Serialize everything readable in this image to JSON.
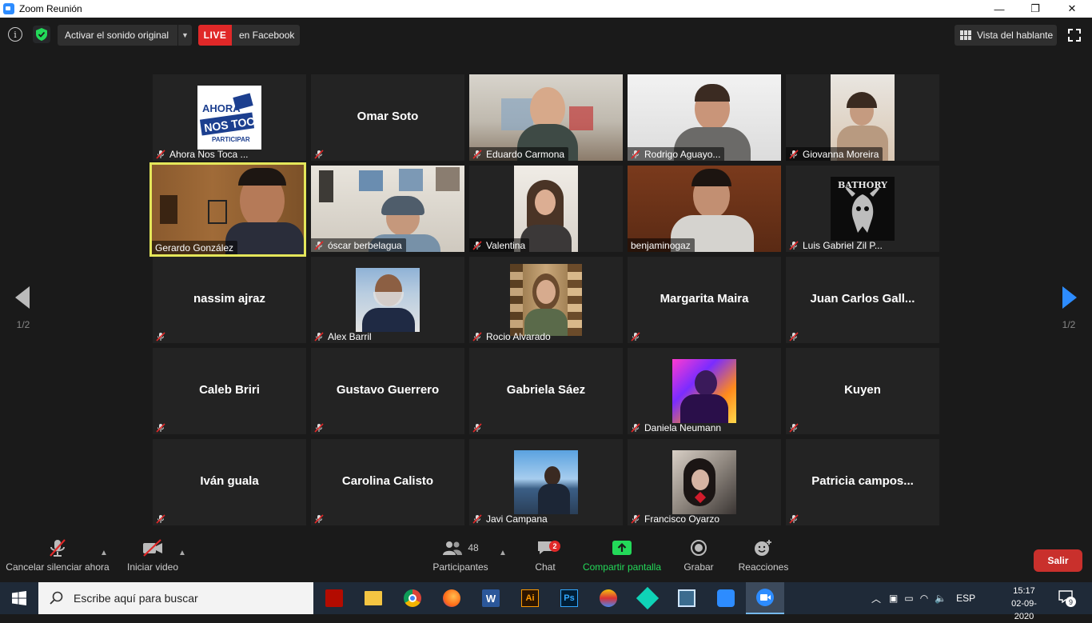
{
  "window": {
    "title": "Zoom Reunión",
    "minimize": "—",
    "maximize": "❐",
    "close": "✕"
  },
  "topbar": {
    "original_sound": "Activar el sonido original",
    "live": "LIVE",
    "live_target": "en Facebook",
    "speaker_view": "Vista del hablante"
  },
  "tiles": [
    {
      "name": "Ahora Nos Toca ...",
      "type": "logo"
    },
    {
      "name": "Omar Soto",
      "type": "name"
    },
    {
      "name": "Eduardo Carmona",
      "type": "video"
    },
    {
      "name": "Rodrigo Aguayo...",
      "type": "video"
    },
    {
      "name": "Giovanna Moreira",
      "type": "photo"
    },
    {
      "name": "Gerardo González",
      "type": "video",
      "active": true
    },
    {
      "name": "óscar berbelagua",
      "type": "video"
    },
    {
      "name": "Valentina",
      "type": "photo"
    },
    {
      "name": "benjaminogaz",
      "type": "video"
    },
    {
      "name": "Luis Gabriel Zil P...",
      "type": "logo2"
    },
    {
      "name": "nassim ajraz",
      "type": "name"
    },
    {
      "name": "Alex Barril",
      "type": "photo"
    },
    {
      "name": "Rocio Alvarado",
      "type": "photo"
    },
    {
      "name": "Margarita Maira",
      "type": "name"
    },
    {
      "name": "Juan Carlos Gall...",
      "type": "name"
    },
    {
      "name": "Caleb Briri",
      "type": "name"
    },
    {
      "name": "Gustavo Guerrero",
      "type": "name"
    },
    {
      "name": "Gabriela Sáez",
      "type": "name"
    },
    {
      "name": "Daniela Neumann",
      "type": "photo"
    },
    {
      "name": "Kuyen",
      "type": "name"
    },
    {
      "name": "Iván guala",
      "type": "name"
    },
    {
      "name": "Carolina Calisto",
      "type": "name"
    },
    {
      "name": "Javi Campana",
      "type": "photo"
    },
    {
      "name": "Francisco Oyarzo",
      "type": "photo"
    },
    {
      "name": "Patricia campos...",
      "type": "name"
    }
  ],
  "logo_text": {
    "line1": "AHORA",
    "line2": "NOS TOCA",
    "line3": "PARTICIPAR",
    "band": "BATHORY"
  },
  "pager": {
    "left": "1/2",
    "right": "1/2"
  },
  "toolbar": {
    "mute": "Cancelar silenciar ahora",
    "video": "Iniciar video",
    "participants": "Participantes",
    "participants_count": "48",
    "chat": "Chat",
    "chat_badge": "2",
    "share": "Compartir pantalla",
    "record": "Grabar",
    "reactions": "Reacciones",
    "leave": "Salir"
  },
  "taskbar": {
    "search_placeholder": "Escribe aquí para buscar",
    "lang": "ESP",
    "time": "15:17",
    "date": "02-09-2020",
    "notifications": "9"
  },
  "colors": {
    "accent_green": "#23d959",
    "leave_red": "#c9302c",
    "active_speaker": "#e4e65a",
    "live_red": "#e02828"
  }
}
